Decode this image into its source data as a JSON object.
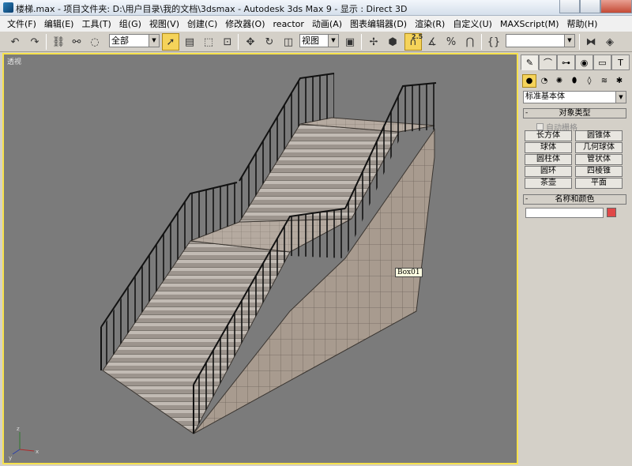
{
  "window": {
    "title": "楼梯.max    - 项目文件夹: D:\\用户目录\\我的文档\\3dsmax    - Autodesk 3ds Max 9    - 显示 : Direct 3D"
  },
  "menu": [
    "文件(F)",
    "编辑(E)",
    "工具(T)",
    "组(G)",
    "视图(V)",
    "创建(C)",
    "修改器(O)",
    "reactor",
    "动画(A)",
    "图表编辑器(D)",
    "渲染(R)",
    "自定义(U)",
    "MAXScript(M)",
    "帮助(H)"
  ],
  "toolbar": {
    "selection_filter": "全部",
    "reference_coord": "视图",
    "snap_badge": "2.5",
    "named_selection": ""
  },
  "viewport": {
    "label": "透视",
    "object_tooltip": "Box01",
    "border_color": "#f7e24c",
    "background_color": "#7b7b7b"
  },
  "command_panel": {
    "category_dropdown": "标准基本体",
    "object_type_rollout": "对象类型",
    "autogrid_label": "自动栅格",
    "buttons": [
      "长方体",
      "圆锥体",
      "球体",
      "几何球体",
      "圆柱体",
      "管状体",
      "圆环",
      "四棱锥",
      "茶壶",
      "平面"
    ],
    "name_color_rollout": "名称和颜色",
    "object_name": "",
    "object_color": "#e04848"
  }
}
